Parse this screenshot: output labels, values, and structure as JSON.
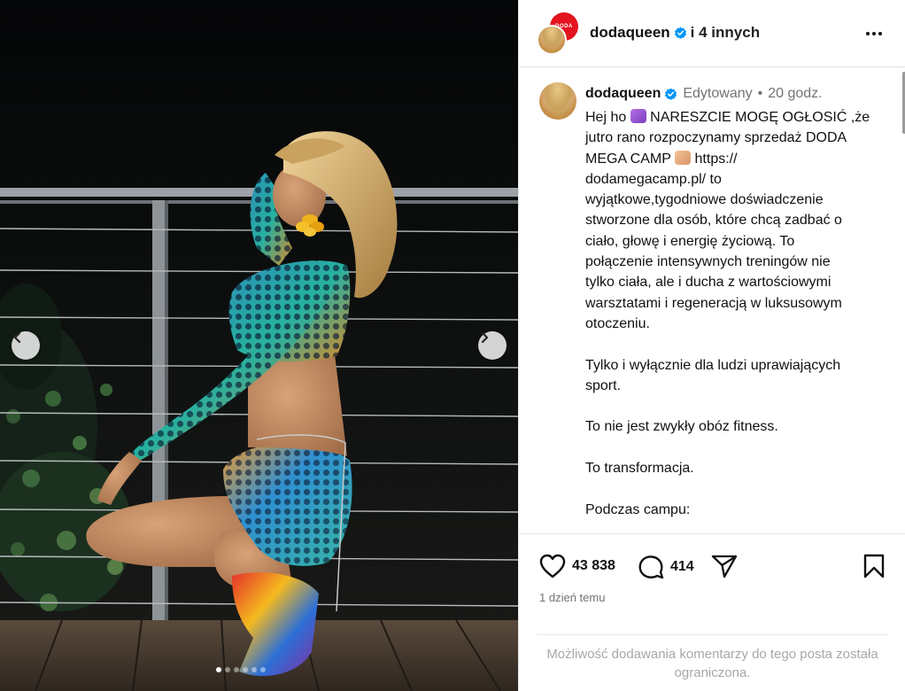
{
  "header": {
    "username": "dodaqueen",
    "others": "i 4 innych",
    "avatar_badge": "DODA"
  },
  "post": {
    "username": "dodaqueen",
    "edited": "Edytowany",
    "separator": "•",
    "time": "20 godz.",
    "caption_paragraphs": [
      "Hej ho",
      "NARESZCIE MOGĘ OGŁOSIĆ ,że\njutro rano rozpoczynamy sprzedaż DODA\nMEGA CAMP",
      "https://\ndodamegacamp.pl/  to\nwyjątkowe,tygodniowe  doświadczenie\nstworzone dla osób, które chcą zadbać o\nciało, głowę i energię życiową. To\npołączenie intensywnych treningów nie\ntylko ciała, ale i ducha z wartościowymi\nwarsztatami i regeneracją w luksusowym\notoczeniu.",
      "Tylko i wyłącznie dla ludzi uprawiających\nsport.",
      "To nie jest zwykły obóz fitness.",
      "To transformacja.",
      "Podczas campu:"
    ]
  },
  "actions": {
    "likes": "43 838",
    "comments": "414",
    "date": "1 dzień temu",
    "restricted_notice": "Możliwość dodawania komentarzy do tego posta została ograniczona."
  },
  "carousel": {
    "total_slides": 6,
    "active_index": 0
  },
  "icons": {
    "prev": "chevron-left-icon",
    "next": "chevron-right-icon",
    "like": "heart-icon",
    "comment": "comment-bubble-icon",
    "share": "paper-plane-icon",
    "save": "bookmark-icon",
    "verified": "verified-badge-icon",
    "more": "more-options-icon"
  },
  "colors": {
    "verified": "#0095f6",
    "red_avatar": "#e3141f",
    "muted": "#737373"
  }
}
